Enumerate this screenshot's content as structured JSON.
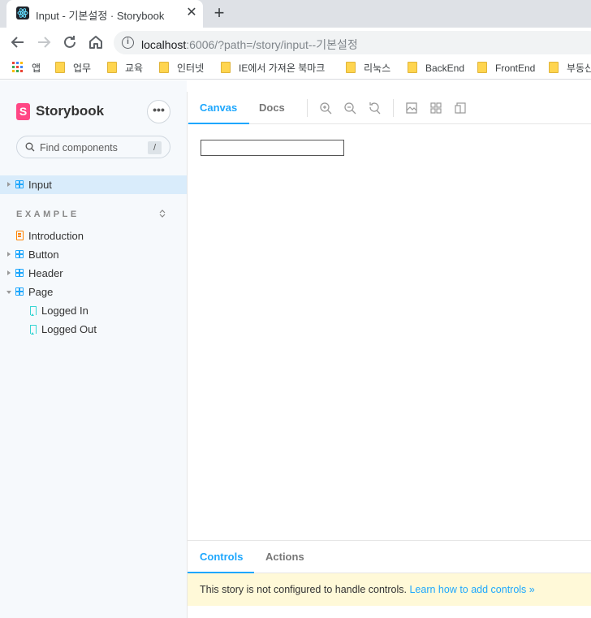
{
  "browser": {
    "tab_title": "Input - 기본설정 · Storybook",
    "close_glyph": "✕",
    "new_tab_glyph": "+",
    "url_host": "localhost",
    "url_rest": ":6006/?path=/story/input--기본설정",
    "info_glyph": "i"
  },
  "bookmarks": [
    {
      "label": "앱",
      "icon": "apps-grid-icon"
    },
    {
      "label": "업무",
      "icon": "folder-icon"
    },
    {
      "label": "교육",
      "icon": "folder-icon"
    },
    {
      "label": "인터넷",
      "icon": "folder-icon"
    },
    {
      "label": "IE에서 가져온 북마크",
      "icon": "folder-icon"
    },
    {
      "label": "리눅스",
      "icon": "folder-icon"
    },
    {
      "label": "BackEnd",
      "icon": "folder-icon"
    },
    {
      "label": "FrontEnd",
      "icon": "folder-icon"
    },
    {
      "label": "부동산",
      "icon": "folder-icon"
    }
  ],
  "sidebar": {
    "logo_mark": "S",
    "logo_text": "Storybook",
    "menu_glyph": "•••",
    "search_placeholder": "Find components",
    "search_shortcut": "/",
    "group_header": "EXAMPLE",
    "expand_glyph": "⌃⌄",
    "items": [
      {
        "label": "Input",
        "icon": "component-icon",
        "selected": true
      },
      {
        "label": "Introduction",
        "icon": "document-icon"
      },
      {
        "label": "Button",
        "icon": "component-icon"
      },
      {
        "label": "Header",
        "icon": "component-icon"
      },
      {
        "label": "Page",
        "icon": "component-icon",
        "expanded": true
      },
      {
        "label": "Logged In",
        "icon": "story-icon"
      },
      {
        "label": "Logged Out",
        "icon": "story-icon"
      }
    ]
  },
  "main": {
    "tabs": [
      {
        "label": "Canvas",
        "active": true
      },
      {
        "label": "Docs"
      }
    ],
    "tools": [
      "zoom-in-icon",
      "zoom-out-icon",
      "zoom-reset-icon",
      "background-icon",
      "grid-icon",
      "viewport-icon"
    ],
    "demo_input_value": ""
  },
  "addons": {
    "tabs": [
      {
        "label": "Controls",
        "active": true
      },
      {
        "label": "Actions"
      }
    ],
    "notice_text": "This story is not configured to handle controls. ",
    "notice_link": "Learn how to add controls »"
  },
  "colors": {
    "accent": "#1ea7fd",
    "brand": "#ff4785",
    "notice_bg": "#fff9d8"
  }
}
